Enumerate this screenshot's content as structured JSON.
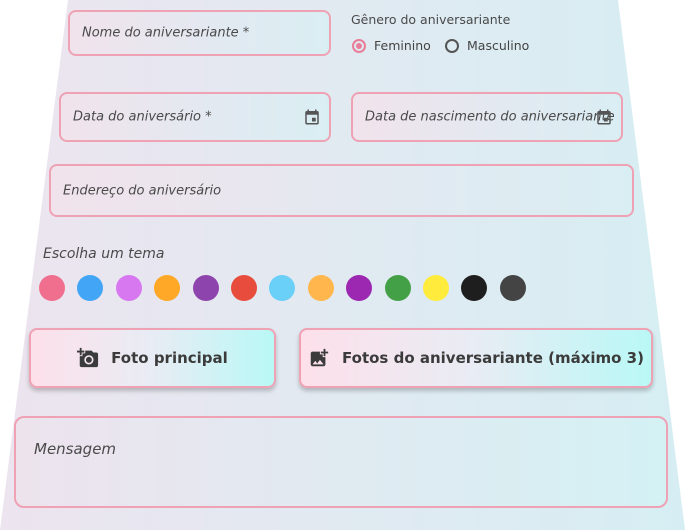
{
  "form": {
    "name_placeholder": "Nome do aniversariante *",
    "gender": {
      "title": "Gênero do aniversariante",
      "options": [
        {
          "label": "Feminino",
          "selected": true
        },
        {
          "label": "Masculino",
          "selected": false
        }
      ]
    },
    "party_date_placeholder": "Data do aniversário *",
    "birth_date_placeholder": "Data de nascimento do aniversariante",
    "address_placeholder": "Endereço do aniversário",
    "theme": {
      "title": "Escolha um tema",
      "colors": [
        "#f06e8e",
        "#42a5f5",
        "#d878f0",
        "#ffa726",
        "#8e44ad",
        "#e74c3c",
        "#6ad0f8",
        "#ffb74d",
        "#9c27b0",
        "#43a047",
        "#ffeb3b",
        "#1e1e1e",
        "#444444"
      ]
    },
    "main_photo_label": "Foto principal",
    "photos_label": "Fotos do aniversariante (máximo 3)",
    "message_placeholder": "Mensagem"
  },
  "icons": {
    "calendar": "calendar-icon",
    "add_photo": "add-photo-icon",
    "add_image": "add-image-icon"
  },
  "colors": {
    "border": "#eea2b4",
    "radio_accent": "#e87e98"
  }
}
